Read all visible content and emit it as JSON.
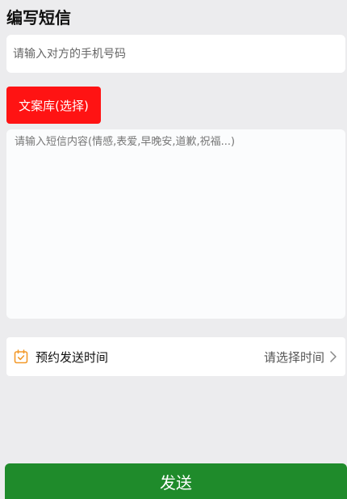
{
  "header": {
    "title": "编写短信"
  },
  "phone": {
    "placeholder": "请输入对方的手机号码"
  },
  "library_button": {
    "label": "文案库(选择)"
  },
  "message": {
    "placeholder": "请输入短信内容(情感,表爱,早晚安,道歉,祝福...)"
  },
  "schedule": {
    "icon": "calendar-check-icon",
    "label": "预约发送时间",
    "value": "请选择时间",
    "chevron": "chevron-right-icon"
  },
  "send_button": {
    "label": "发送"
  },
  "colors": {
    "background": "#ececee",
    "library_button": "#ff1313",
    "send_button": "#1f8b2b",
    "calendar_icon": "#f39a2b"
  }
}
